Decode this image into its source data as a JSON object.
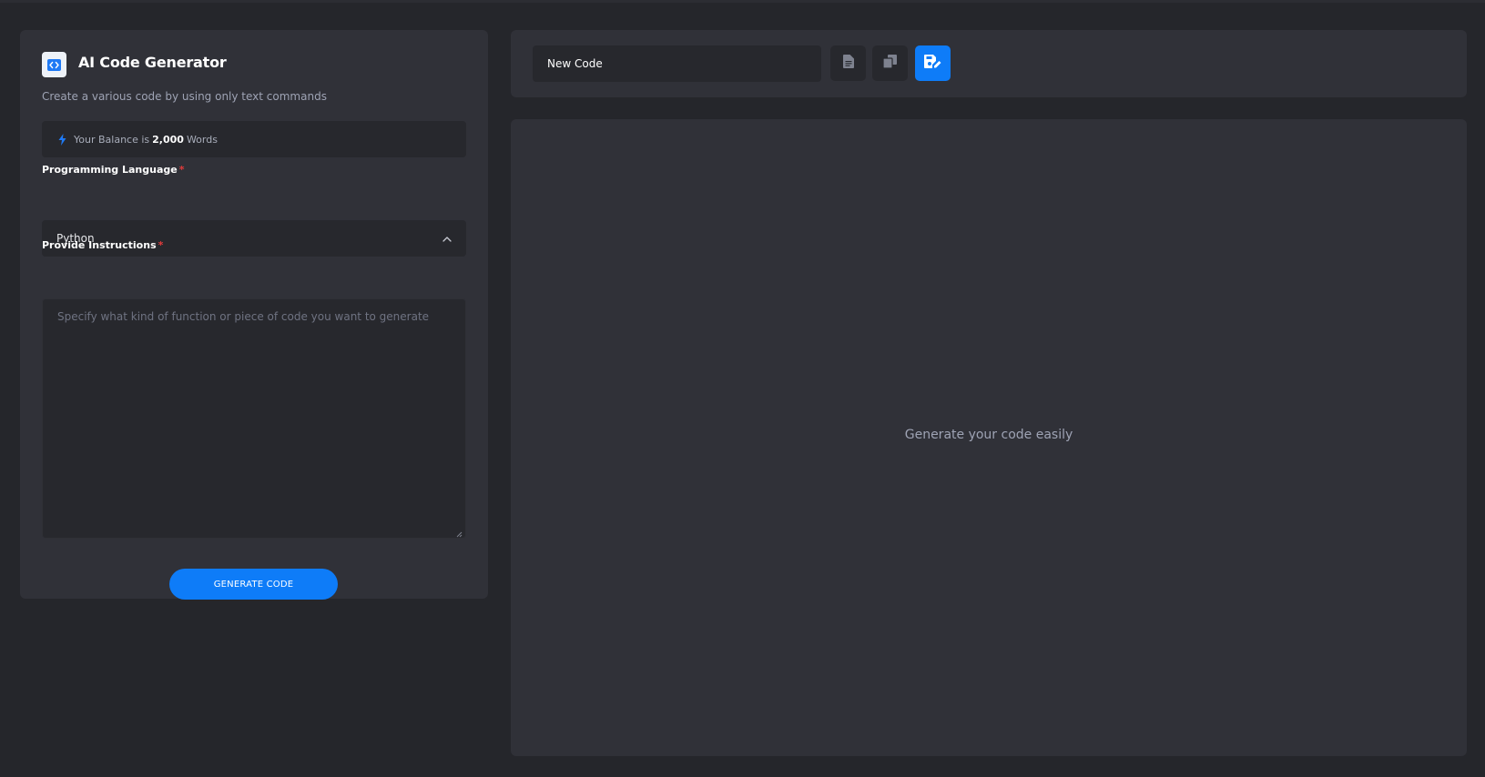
{
  "app": {
    "title": "AI Code Generator",
    "subtitle": "Create a various code by using only text commands"
  },
  "balance": {
    "prefix": "Your Balance is",
    "amount": "2,000",
    "unit": "Words"
  },
  "form": {
    "language_label": "Programming Language",
    "language_value": "Python",
    "instructions_label": "Provide Instructions",
    "instructions_placeholder": "Specify what kind of function or piece of code you want to generate",
    "required_marker": "*",
    "generate_label": "GENERATE CODE"
  },
  "output": {
    "name_value": "New Code",
    "placeholder": "Generate your code easily",
    "toolbar": [
      "document-icon",
      "copy-icon",
      "save-edit-icon"
    ]
  },
  "colors": {
    "background": "#25262b",
    "panel": "#303138",
    "field": "#27282d",
    "accent": "#0e7cf8",
    "required": "#e23b3b"
  }
}
